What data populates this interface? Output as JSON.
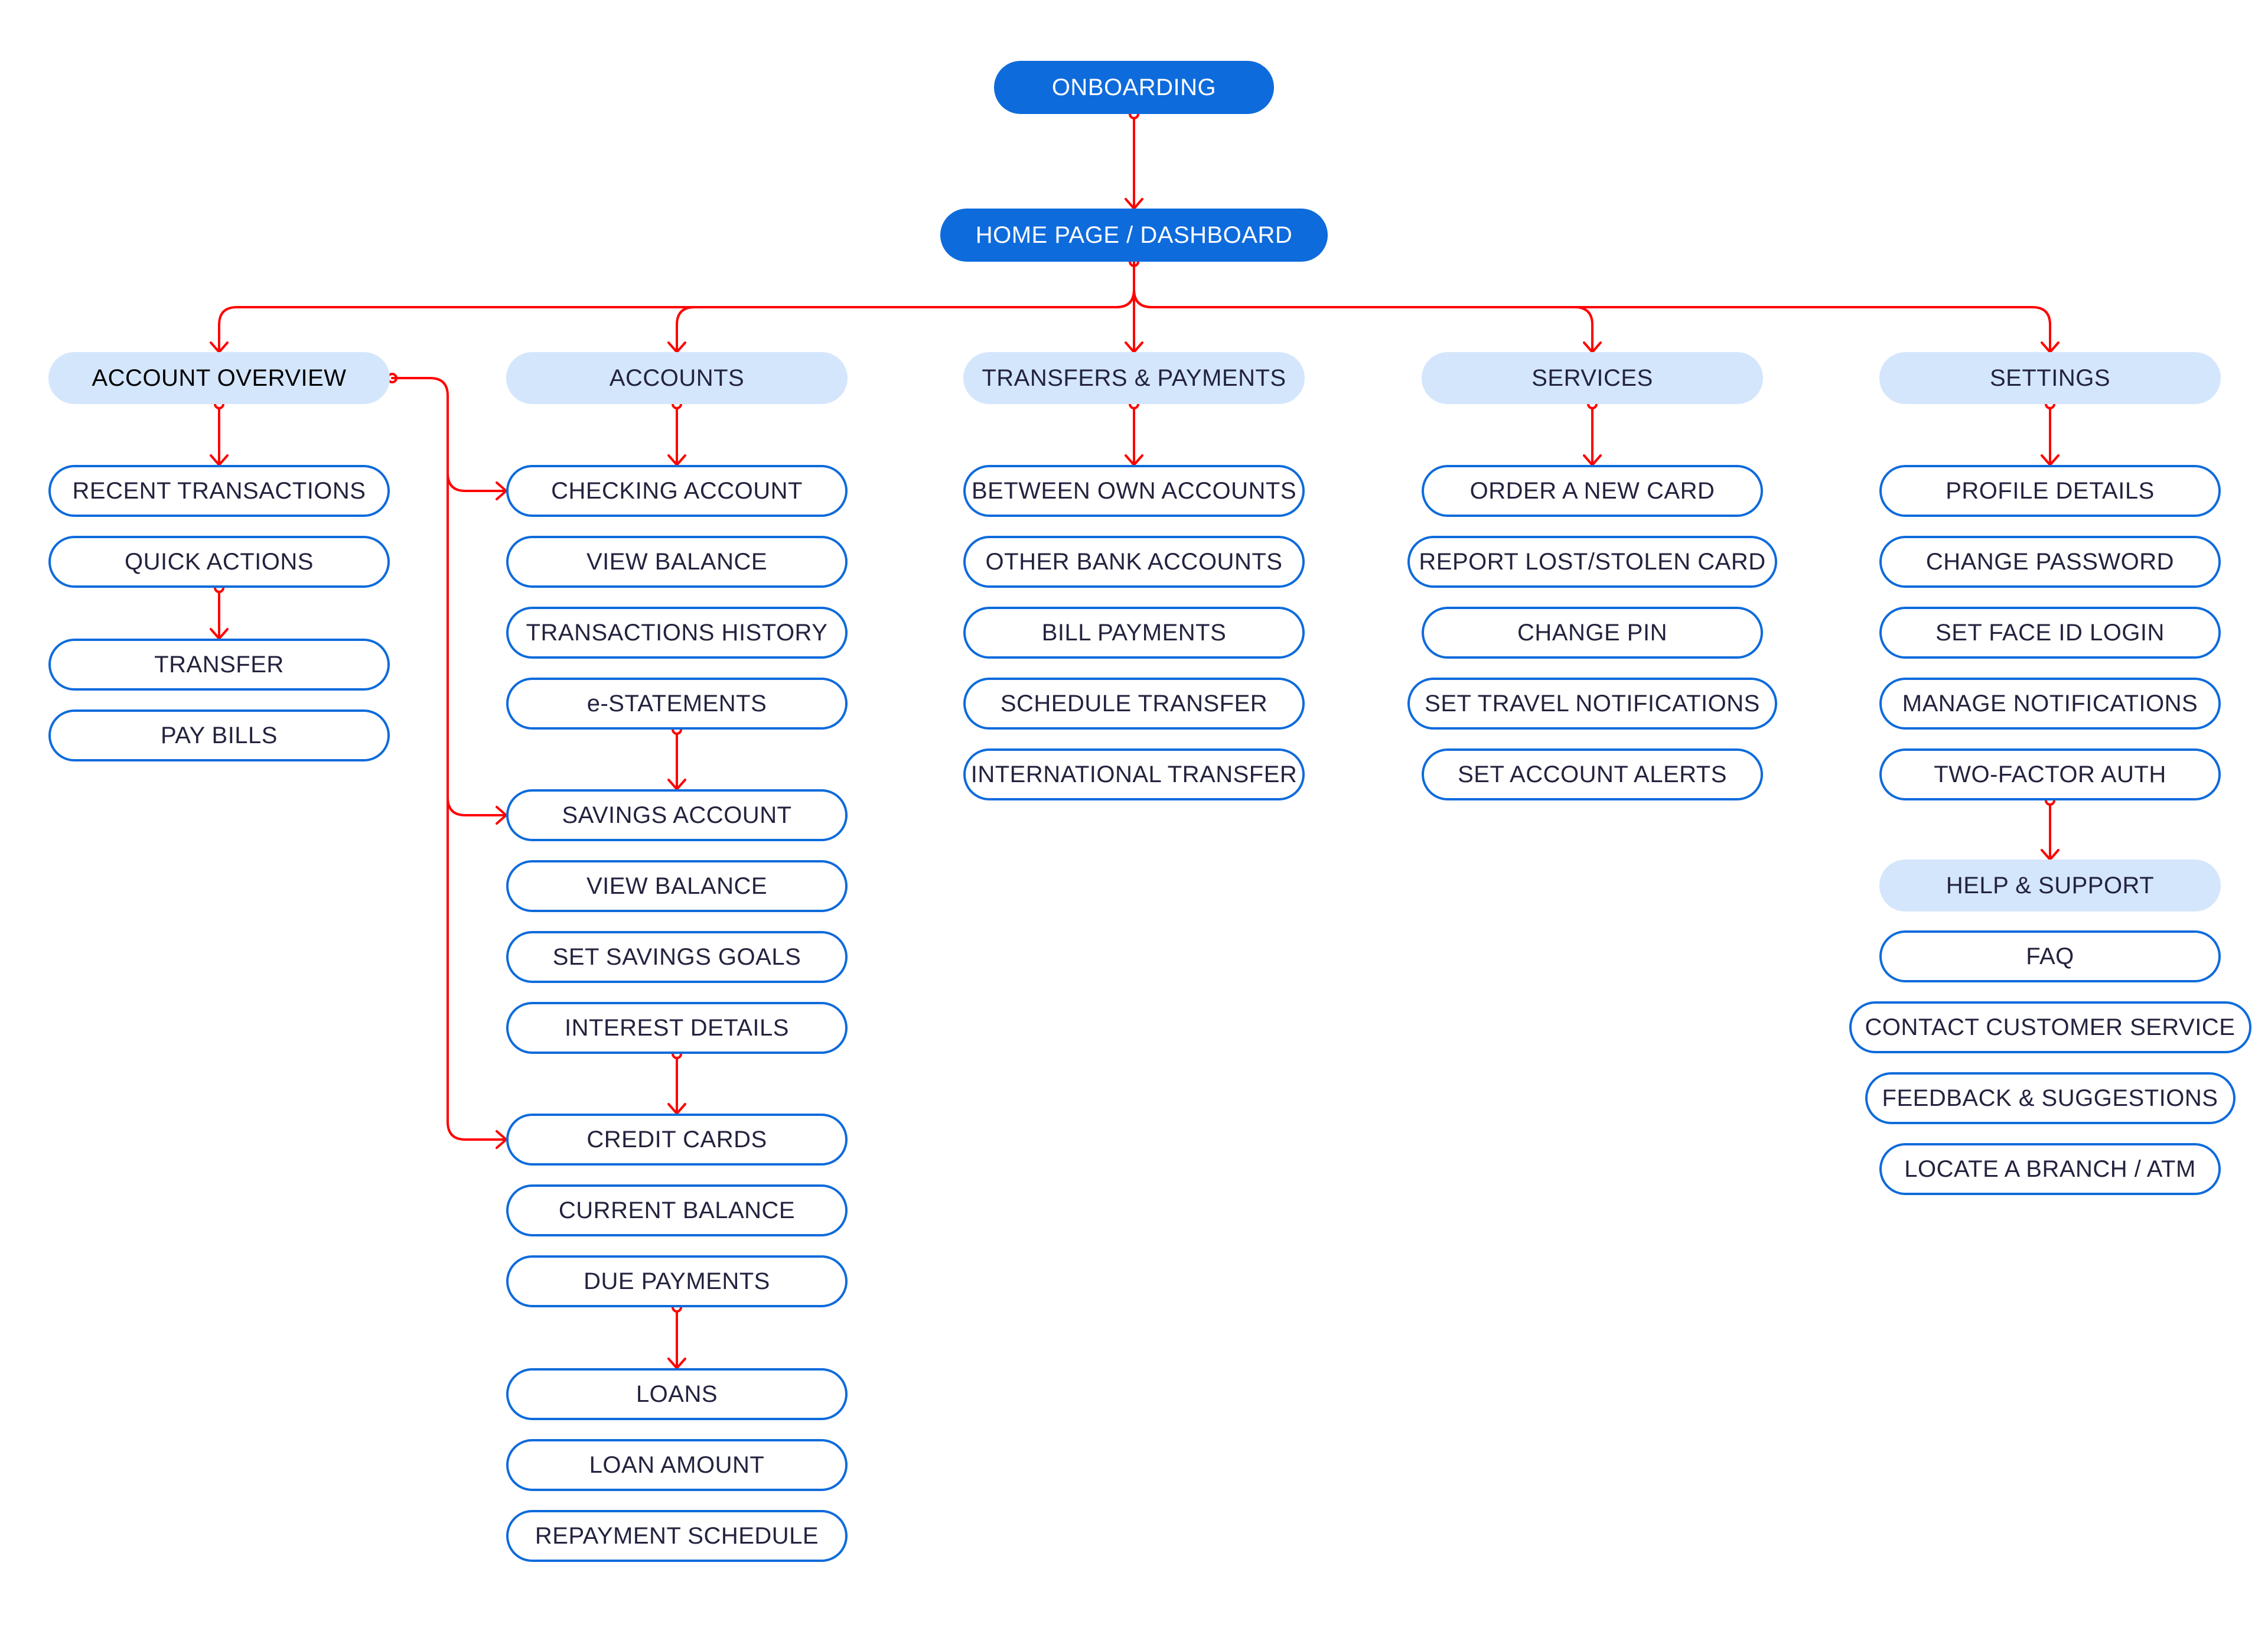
{
  "colors": {
    "primary_fill": "#0E6BDC",
    "category_fill": "#D4E6FC",
    "item_border": "#0E6BDC",
    "connector": "#FF0000",
    "text": "#23233F"
  },
  "root": {
    "label": "ONBOARDING"
  },
  "home": {
    "label": "HOME PAGE / DASHBOARD"
  },
  "columns": [
    {
      "label": "ACCOUNT OVERVIEW",
      "groups": [
        {
          "items": [
            "RECENT TRANSACTIONS",
            "QUICK ACTIONS"
          ]
        },
        {
          "items": [
            "TRANSFER",
            "PAY BILLS"
          ]
        }
      ]
    },
    {
      "label": "ACCOUNTS",
      "groups": [
        {
          "items": [
            "CHECKING ACCOUNT",
            "VIEW BALANCE",
            "TRANSACTIONS HISTORY",
            "e-STATEMENTS"
          ]
        },
        {
          "items": [
            "SAVINGS ACCOUNT",
            "VIEW BALANCE",
            "SET SAVINGS GOALS",
            "INTEREST DETAILS"
          ]
        },
        {
          "items": [
            "CREDIT CARDS",
            "CURRENT BALANCE",
            "DUE PAYMENTS"
          ]
        },
        {
          "items": [
            "LOANS",
            "LOAN AMOUNT",
            "REPAYMENT SCHEDULE"
          ]
        }
      ]
    },
    {
      "label": "TRANSFERS & PAYMENTS",
      "groups": [
        {
          "items": [
            "BETWEEN OWN ACCOUNTS",
            "OTHER BANK ACCOUNTS",
            "BILL PAYMENTS",
            "SCHEDULE TRANSFER",
            "INTERNATIONAL TRANSFER"
          ]
        }
      ]
    },
    {
      "label": "SERVICES",
      "groups": [
        {
          "items": [
            "ORDER A NEW CARD",
            "REPORT LOST/STOLEN CARD",
            "CHANGE PIN",
            "SET TRAVEL NOTIFICATIONS",
            "SET ACCOUNT ALERTS"
          ]
        }
      ]
    },
    {
      "label": "SETTINGS",
      "groups": [
        {
          "items": [
            "PROFILE DETAILS",
            "CHANGE PASSWORD",
            "SET FACE ID LOGIN",
            "MANAGE NOTIFICATIONS",
            "TWO-FACTOR AUTH"
          ]
        }
      ],
      "sub_section": {
        "label": "HELP & SUPPORT",
        "items": [
          "FAQ",
          "CONTACT CUSTOMER SERVICE",
          "FEEDBACK & SUGGESTIONS",
          "LOCATE A BRANCH / ATM"
        ]
      }
    }
  ]
}
